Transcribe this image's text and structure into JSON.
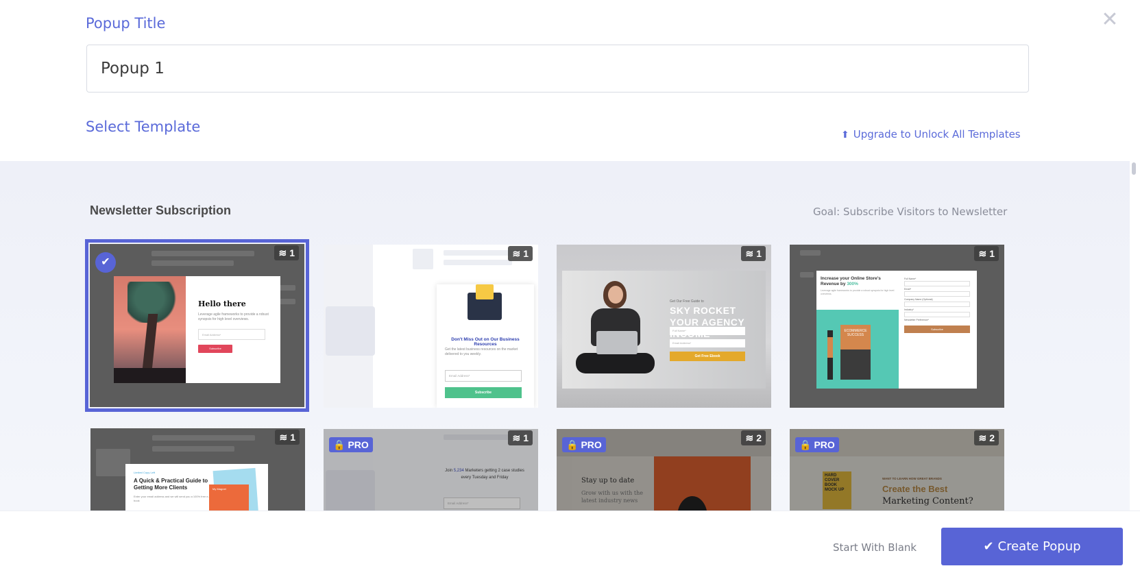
{
  "header": {
    "popup_title_label": "Popup Title",
    "popup_title_value": "Popup 1",
    "select_template_label": "Select Template",
    "upgrade_link": "Upgrade to Unlock All Templates",
    "close_icon": "close-icon"
  },
  "category": {
    "title": "Newsletter Subscription",
    "goal": "Goal: Subscribe Visitors to Newsletter"
  },
  "templates": [
    {
      "layers": "1",
      "selected": true,
      "pro": false,
      "heading": "Hello there",
      "text": "Leverage agile frameworks to provide a robust synopsis for high level overviews.",
      "input_placeholder": "Email Address*",
      "button": "Subscribe"
    },
    {
      "layers": "1",
      "pro": false,
      "heading": "Don't Miss Out on Our Business Resources",
      "text": "Get the latest business resources on the market delivered to you weekly.",
      "input_placeholder": "Email Address*",
      "button": "Subscribe"
    },
    {
      "layers": "1",
      "pro": false,
      "small": "Get Our Free Guide to",
      "heading": "SKY ROCKET YOUR AGENCY INCOME",
      "input1": "Full Name*",
      "input2": "Email Address*",
      "button": "Get Free Ebook"
    },
    {
      "layers": "1",
      "pro": false,
      "heading_part1": "Increase your Online Store's Revenue by",
      "heading_highlight": "300%",
      "text": "Leverage agile frameworks to provide a robust synopsis for high level overviews.",
      "book_title": "ECOMMERCE SUCCESS",
      "label1": "Full Name*",
      "label2": "Email*",
      "label3": "Company Name (Optional)",
      "label4": "Industry*",
      "label5": "Newsletter Preference*",
      "button": "Subscribe"
    },
    {
      "layers": "1",
      "pro": false,
      "kicker": "Limited Copy Left",
      "heading": "A Quick & Practical Guide to Getting More Clients",
      "text": "Enter your email address and we will send you a 100% free e-book",
      "book_label": "My Magnet"
    },
    {
      "layers": "1",
      "pro": true,
      "pro_label": "PRO",
      "text_prefix": "Join",
      "text_highlight": "5,234",
      "text_suffix": "Marketers getting 2 case studies every Tuesday and Friday",
      "input_placeholder": "Email Address*"
    },
    {
      "layers": "2",
      "pro": true,
      "pro_label": "PRO",
      "heading": "Stay up to date",
      "text": "Grow with us with the latest industry news"
    },
    {
      "layers": "2",
      "pro": true,
      "pro_label": "PRO",
      "book": "HARD COVER BOOK MOCK UP",
      "kicker": "WANT TO LEARN HOW GREAT BRANDS",
      "heading1": "Create the Best",
      "heading2": "Marketing Content?"
    }
  ],
  "footer": {
    "blank_button": "Start With Blank",
    "create_button": "Create Popup"
  },
  "colors": {
    "accent": "#5864d6",
    "label_blue": "#5a6ad9"
  }
}
